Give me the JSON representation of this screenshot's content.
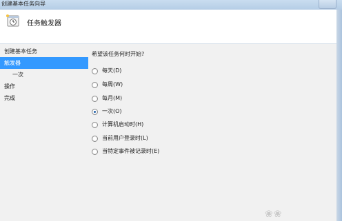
{
  "window": {
    "title": "创建基本任务向导"
  },
  "header": {
    "title": "任务触发器",
    "icon": "task-scheduler-clock-icon"
  },
  "steps": [
    {
      "label": "创建基本任务",
      "active": false,
      "sub": false
    },
    {
      "label": "触发器",
      "active": true,
      "sub": false
    },
    {
      "label": "一次",
      "active": false,
      "sub": true
    },
    {
      "label": "操作",
      "active": false,
      "sub": false
    },
    {
      "label": "完成",
      "active": false,
      "sub": false
    }
  ],
  "question": "希望该任务何时开始?",
  "options": [
    {
      "label": "每天(D)",
      "checked": false
    },
    {
      "label": "每周(W)",
      "checked": false
    },
    {
      "label": "每月(M)",
      "checked": false
    },
    {
      "label": "一次(O)",
      "checked": true
    },
    {
      "label": "计算机启动时(H)",
      "checked": false
    },
    {
      "label": "当前用户登录时(L)",
      "checked": false
    },
    {
      "label": "当特定事件被记录时(E)",
      "checked": false
    }
  ],
  "colors": {
    "selected": "#3399ff",
    "accent": "#1f5fa8"
  }
}
